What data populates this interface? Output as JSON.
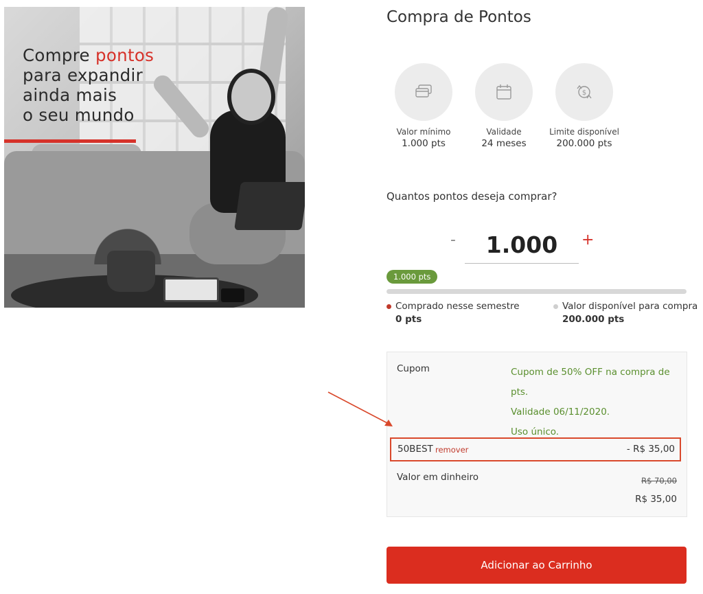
{
  "promo": {
    "headline_line1_prefix": "Compre",
    "headline_line1_accent": "pontos",
    "headline_line2": "para expandir",
    "headline_line3": "ainda mais",
    "headline_line4": "o seu mundo"
  },
  "page": {
    "title": "Compra de Pontos"
  },
  "info_cards": [
    {
      "icon": "credit-card-icon",
      "label": "Valor mínimo",
      "value": "1.000 pts"
    },
    {
      "icon": "calendar-icon",
      "label": "Validade",
      "value": "24 meses"
    },
    {
      "icon": "money-exchange-icon",
      "label": "Limite disponível",
      "value": "200.000 pts"
    }
  ],
  "purchase": {
    "question": "Quantos pontos deseja comprar?",
    "minus_label": "-",
    "plus_label": "+",
    "quantity": "1.000",
    "badge": "1.000 pts",
    "progress_fraction": 0
  },
  "legend": {
    "bought_label": "Comprado nesse semestre",
    "bought_value": "0 pts",
    "available_label": "Valor disponível para compra",
    "available_value": "200.000 pts"
  },
  "coupon": {
    "label": "Cupom",
    "desc_line1": "Cupom de 50% OFF na compra de pts.",
    "desc_line2": "Validade 06/11/2020.",
    "desc_line3": "Uso único.",
    "code": "50BEST",
    "remove_label": "remover",
    "discount": "- R$ 35,00",
    "cash_label": "Valor em dinheiro",
    "old_price": "R$ 70,00",
    "new_price": "R$ 35,00"
  },
  "cta": {
    "add_to_cart": "Adicionar ao Carrinho"
  },
  "colors": {
    "accent": "#db2d1f",
    "success": "#5a8f2e",
    "badge": "#6a9a3c"
  }
}
